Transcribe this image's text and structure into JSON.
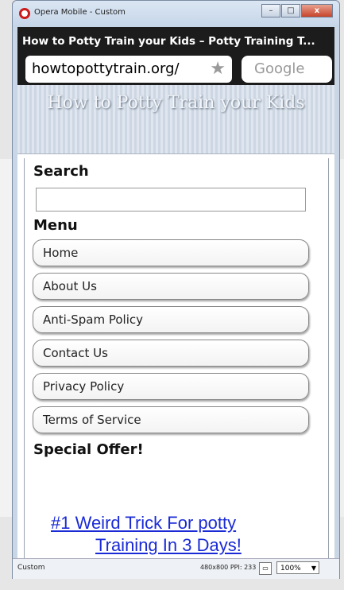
{
  "window": {
    "title": "Opera Mobile - Custom",
    "buttons": {
      "minimize": "–",
      "maximize": "□",
      "close": "x"
    }
  },
  "browser": {
    "tab_title": "How to Potty Train your Kids – Potty Training T...",
    "address": "howtopottytrain.org/",
    "search_placeholder": "Google"
  },
  "page": {
    "banner_title": "How to Potty Train your Kids",
    "search_label": "Search",
    "menu_label": "Menu",
    "menu_items": [
      {
        "label": "Home"
      },
      {
        "label": "About Us"
      },
      {
        "label": "Anti-Spam Policy"
      },
      {
        "label": "Contact Us"
      },
      {
        "label": "Privacy Policy"
      },
      {
        "label": "Terms of Service"
      }
    ],
    "special_offer_label": "Special Offer!",
    "ad": {
      "line1": "#1 Weird Trick For potty",
      "line2": "Training In 3 Days!"
    }
  },
  "status": {
    "profile": "Custom",
    "resolution": "480x800  PPI: 233",
    "zoom": "100%"
  },
  "colors": {
    "accent": "#1a2bd6",
    "brand_red": "#cc1b1b"
  }
}
